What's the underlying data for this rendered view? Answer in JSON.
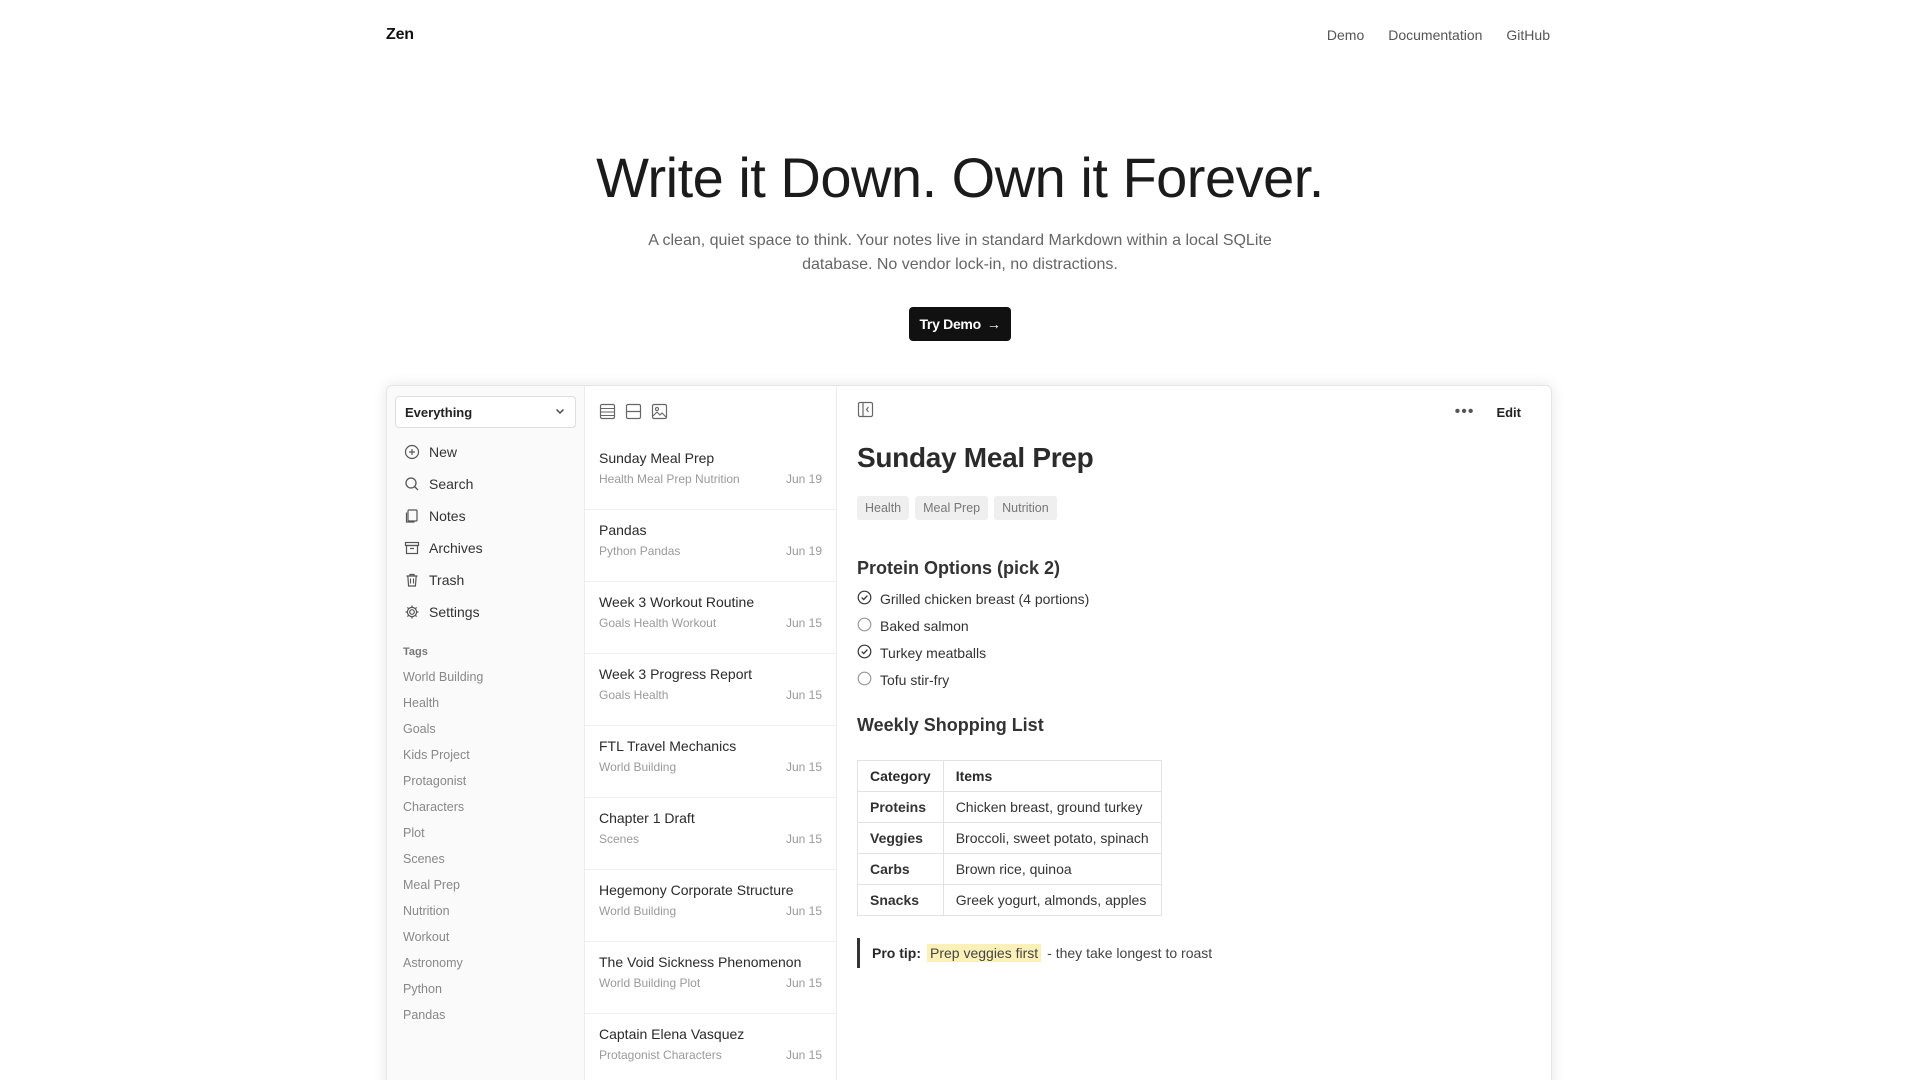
{
  "nav": {
    "brand": "Zen",
    "links": [
      "Demo",
      "Documentation",
      "GitHub"
    ]
  },
  "hero": {
    "headline": "Write it Down. Own it Forever.",
    "subtitle": "A clean, quiet space to think. Your notes live in standard Markdown within a local SQLite database. No vendor lock-in, no distractions.",
    "cta_label": "Try Demo",
    "cta_icon": "arrow-right-icon"
  },
  "sidebar": {
    "selector_value": "Everything",
    "menu": [
      {
        "label": "New",
        "icon": "plus-circle-icon"
      },
      {
        "label": "Search",
        "icon": "search-icon"
      },
      {
        "label": "Notes",
        "icon": "notes-icon"
      },
      {
        "label": "Archives",
        "icon": "archive-icon"
      },
      {
        "label": "Trash",
        "icon": "trash-icon"
      },
      {
        "label": "Settings",
        "icon": "gear-icon"
      }
    ],
    "tags_title": "Tags",
    "tags": [
      "World Building",
      "Health",
      "Goals",
      "Kids Project",
      "Protagonist",
      "Characters",
      "Plot",
      "Scenes",
      "Meal Prep",
      "Nutrition",
      "Workout",
      "Astronomy",
      "Python",
      "Pandas"
    ]
  },
  "notelist": {
    "toolbar_icons": [
      "list-view-icon",
      "card-view-icon",
      "gallery-view-icon"
    ],
    "notes": [
      {
        "title": "Sunday Meal Prep",
        "tags": "Health Meal Prep Nutrition",
        "date": "Jun 19"
      },
      {
        "title": "Pandas",
        "tags": "Python Pandas",
        "date": "Jun 19"
      },
      {
        "title": "Week 3 Workout Routine",
        "tags": "Goals Health Workout",
        "date": "Jun 15"
      },
      {
        "title": "Week 3 Progress Report",
        "tags": "Goals Health",
        "date": "Jun 15"
      },
      {
        "title": "FTL Travel Mechanics",
        "tags": "World Building",
        "date": "Jun 15"
      },
      {
        "title": "Chapter 1 Draft",
        "tags": "Scenes",
        "date": "Jun 15"
      },
      {
        "title": "Hegemony Corporate Structure",
        "tags": "World Building",
        "date": "Jun 15"
      },
      {
        "title": "The Void Sickness Phenomenon",
        "tags": "World Building Plot",
        "date": "Jun 15"
      },
      {
        "title": "Captain Elena Vasquez",
        "tags": "Protagonist Characters",
        "date": "Jun 15"
      }
    ]
  },
  "editor": {
    "edit_label": "Edit",
    "more_icon": "more-horizontal-icon",
    "sidebar_toggle_icon": "sidebar-toggle-icon",
    "title": "Sunday Meal Prep",
    "tags": [
      "Health",
      "Meal Prep",
      "Nutrition"
    ],
    "section1_heading": "Protein Options (pick 2)",
    "checklist": [
      {
        "label": "Grilled chicken breast (4 portions)",
        "checked": true
      },
      {
        "label": "Baked salmon",
        "checked": false
      },
      {
        "label": "Turkey meatballs",
        "checked": true
      },
      {
        "label": "Tofu stir-fry",
        "checked": false
      }
    ],
    "section2_heading": "Weekly Shopping List",
    "table": {
      "headers": [
        "Category",
        "Items"
      ],
      "rows": [
        [
          "Proteins",
          "Chicken breast, ground turkey"
        ],
        [
          "Veggies",
          "Broccoli, sweet potato, spinach"
        ],
        [
          "Carbs",
          "Brown rice, quinoa"
        ],
        [
          "Snacks",
          "Greek yogurt, almonds, apples"
        ]
      ]
    },
    "callout": {
      "label": "Pro tip:",
      "highlight": "Prep veggies first",
      "rest": "- they take longest to roast"
    }
  }
}
